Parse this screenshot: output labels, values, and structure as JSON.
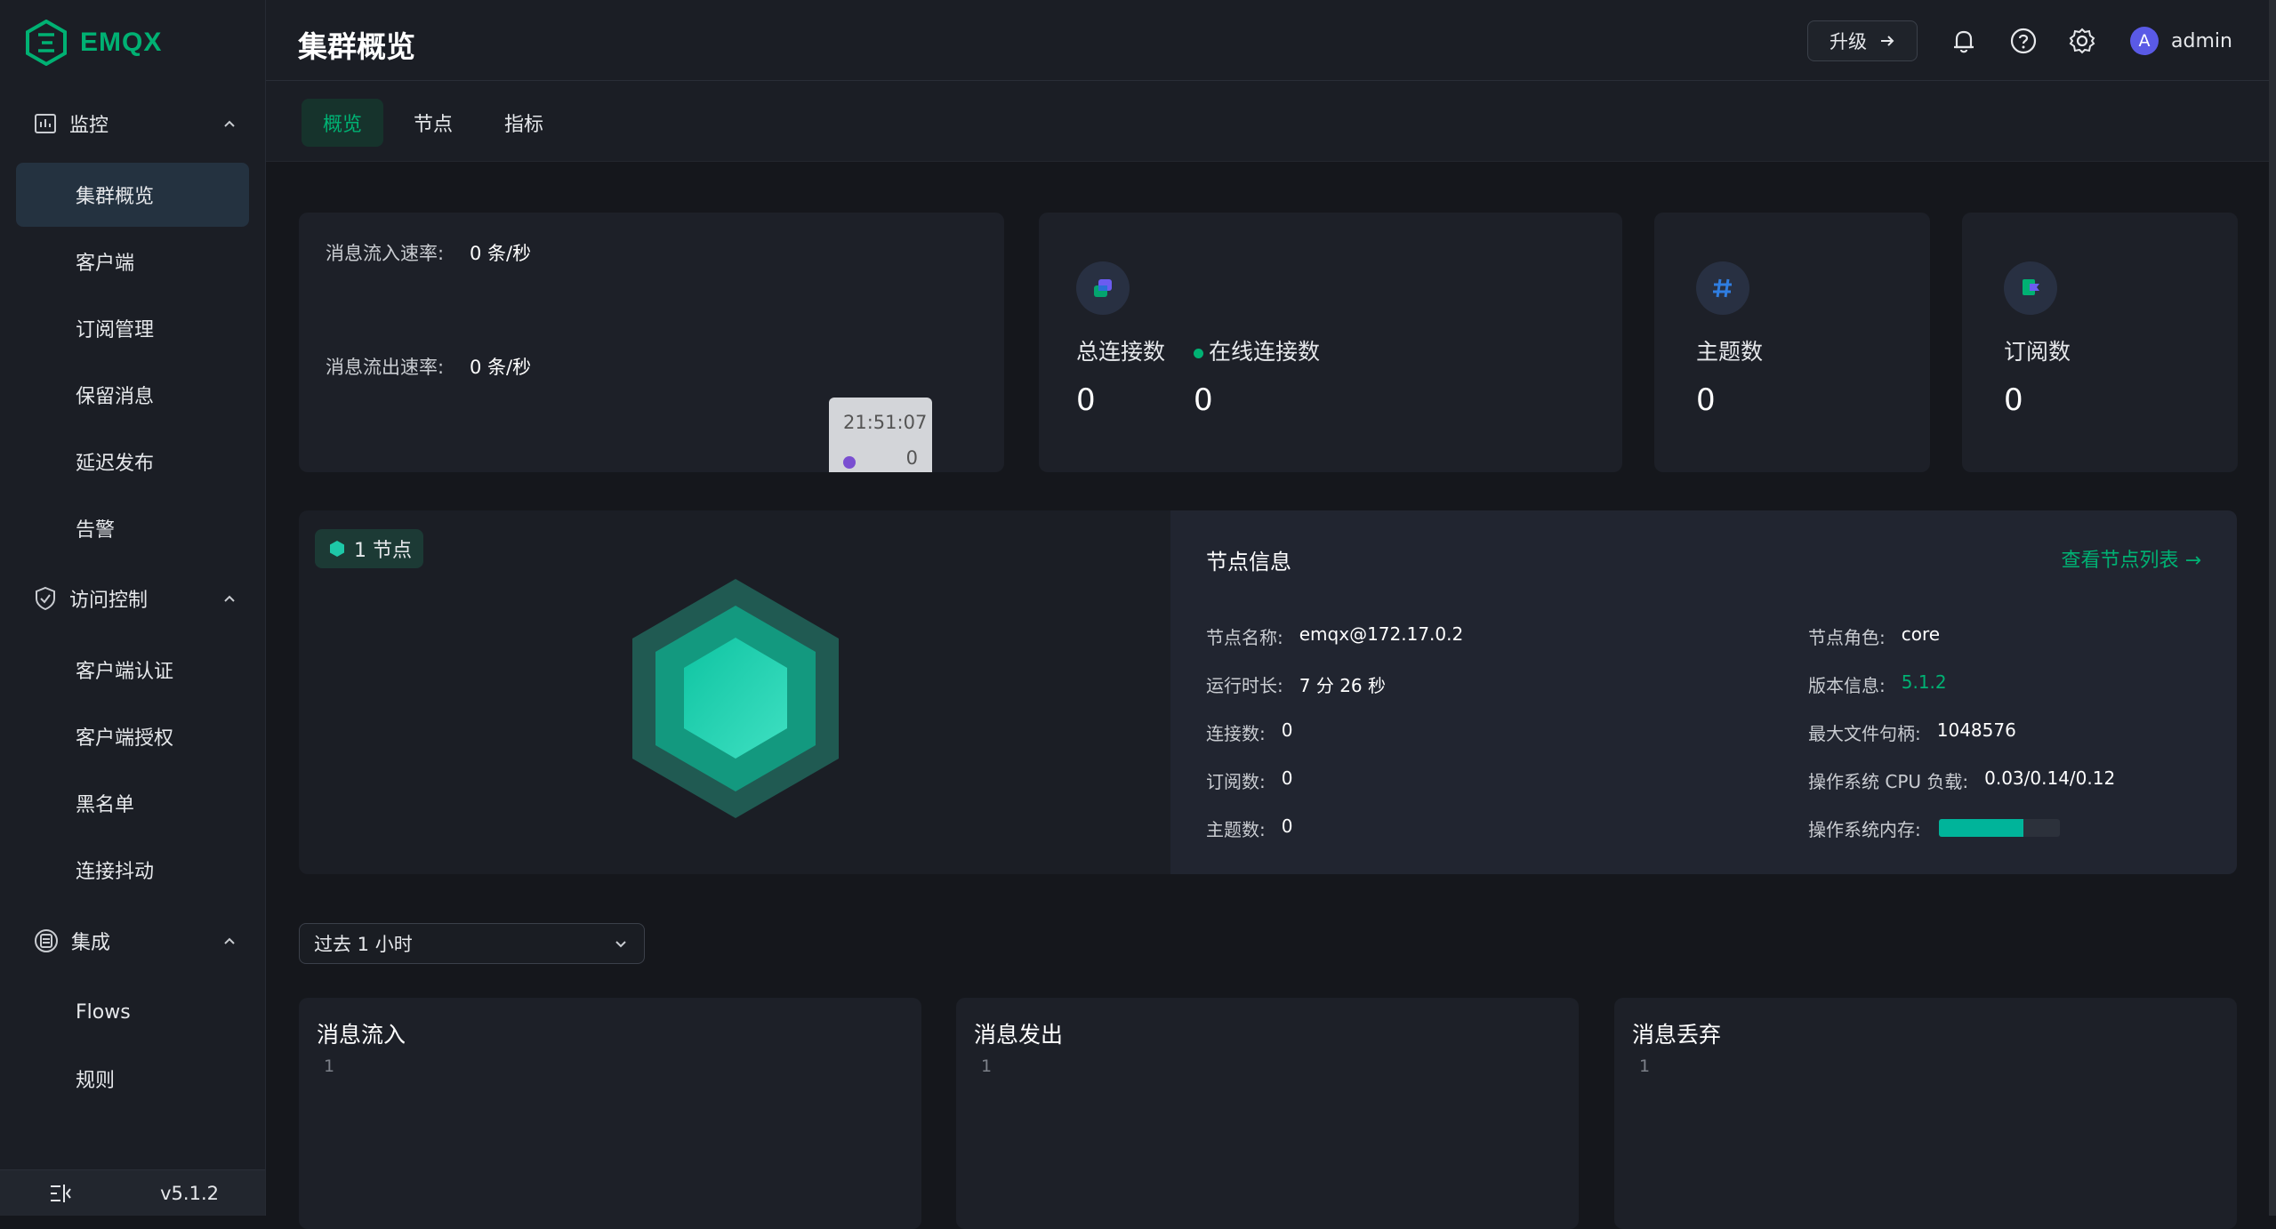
{
  "app": {
    "logo_text": "EMQX",
    "version": "v5.1.2"
  },
  "sidebar": {
    "groups": [
      {
        "label": "监控",
        "icon": "chart-icon",
        "items": [
          "集群概览",
          "客户端",
          "订阅管理",
          "保留消息",
          "延迟发布",
          "告警"
        ]
      },
      {
        "label": "访问控制",
        "icon": "shield-icon",
        "items": [
          "客户端认证",
          "客户端授权",
          "黑名单",
          "连接抖动"
        ]
      },
      {
        "label": "集成",
        "icon": "integration-icon",
        "items": [
          "Flows",
          "规则"
        ]
      }
    ],
    "active_item": "集群概览"
  },
  "header": {
    "title": "集群概览",
    "upgrade_label": "升级",
    "user_initial": "A",
    "username": "admin"
  },
  "tabs": [
    "概览",
    "节点",
    "指标"
  ],
  "active_tab": "概览",
  "rates": {
    "in_label": "消息流入速率:",
    "in_value": "0 条/秒",
    "out_label": "消息流出速率:",
    "out_value": "0 条/秒",
    "tooltip_time": "21:51:07",
    "tooltip_value": "0"
  },
  "stats": {
    "total_conn_label": "总连接数",
    "total_conn_value": "0",
    "online_conn_label": "在线连接数",
    "online_conn_value": "0",
    "topics_label": "主题数",
    "topics_value": "0",
    "subs_label": "订阅数",
    "subs_value": "0"
  },
  "node": {
    "badge": "1 节点",
    "info_title": "节点信息",
    "list_link": "查看节点列表",
    "left": [
      {
        "k": "节点名称:",
        "v": "emqx@172.17.0.2"
      },
      {
        "k": "运行时长:",
        "v": "7 分 26 秒"
      },
      {
        "k": "连接数:",
        "v": "0"
      },
      {
        "k": "订阅数:",
        "v": "0"
      },
      {
        "k": "主题数:",
        "v": "0"
      }
    ],
    "right": [
      {
        "k": "节点角色:",
        "v": "core"
      },
      {
        "k": "版本信息:",
        "v": "5.1.2"
      },
      {
        "k": "最大文件句柄:",
        "v": "1048576"
      },
      {
        "k": "操作系统 CPU 负载:",
        "v": "0.03/0.14/0.12"
      },
      {
        "k": "操作系统内存:",
        "v": ""
      }
    ],
    "memory_fraction": 0.7
  },
  "time_range": "过去 1 小时",
  "metrics": [
    {
      "title": "消息流入",
      "axis_top": "1"
    },
    {
      "title": "消息发出",
      "axis_top": "1"
    },
    {
      "title": "消息丢弃",
      "axis_top": "1"
    }
  ],
  "colors": {
    "accent": "#00b173",
    "bg": "#15171c",
    "card": "#1d2028"
  }
}
